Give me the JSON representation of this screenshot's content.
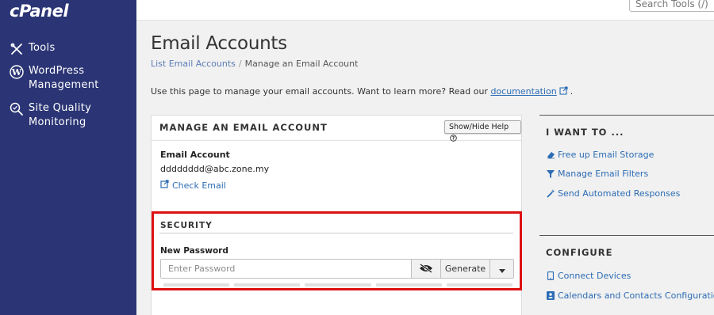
{
  "sidebar": {
    "logo": "cPanel",
    "items": [
      {
        "label": "Tools",
        "icon": "tools-icon"
      },
      {
        "label": "WordPress\nManagement",
        "icon": "wordpress-icon"
      },
      {
        "label": "Site Quality\nMonitoring",
        "icon": "magnifier-icon"
      }
    ]
  },
  "header": {
    "search_placeholder": "Search Tools (/)"
  },
  "page": {
    "title": "Email Accounts",
    "breadcrumb": {
      "parent": "List Email Accounts",
      "separator": "/",
      "current": "Manage an Email Account"
    },
    "intro_text": "Use this page to manage your email accounts. Want to learn more? Read our ",
    "intro_link": "documentation",
    "intro_end": "."
  },
  "manage_panel": {
    "title": "MANAGE AN EMAIL ACCOUNT",
    "help_button": "Show/Hide Help",
    "account_label": "Email Account",
    "account_value": "dddddddd@abc.zone.my",
    "check_email_link": "Check Email"
  },
  "security": {
    "title": "SECURITY",
    "password_label": "New Password",
    "password_placeholder": "Enter Password",
    "password_value": "",
    "generate_label": "Generate",
    "strength_segments": 5
  },
  "i_want_to": {
    "title": "I WANT TO ...",
    "links": [
      {
        "label": "Free up Email Storage",
        "icon": "eraser-icon"
      },
      {
        "label": "Manage Email Filters",
        "icon": "filter-icon"
      },
      {
        "label": "Send Automated Responses",
        "icon": "magic-wand-icon"
      }
    ]
  },
  "configure": {
    "title": "CONFIGURE",
    "links": [
      {
        "label": "Connect Devices",
        "icon": "mobile-icon"
      },
      {
        "label": "Calendars and Contacts Configuration",
        "icon": "address-book-icon"
      }
    ]
  },
  "colors": {
    "sidebar_bg": "#2b3575",
    "link": "#2c6cb4",
    "highlight": "#dd1111"
  }
}
